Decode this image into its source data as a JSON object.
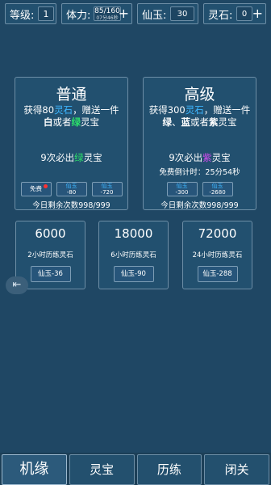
{
  "stats": {
    "level": {
      "label": "等级:",
      "value": "1"
    },
    "stamina": {
      "label": "体力:",
      "value": "85/160",
      "timer": "07分46秒",
      "plus": "+"
    },
    "jade": {
      "label": "仙玉:",
      "value": "30"
    },
    "stone": {
      "label": "灵石:",
      "value": "0",
      "plus": "+"
    }
  },
  "normal": {
    "title": "普通",
    "desc_a": "获得80",
    "desc_b": "灵石",
    "desc_c": "，赠送一件",
    "desc2_a": "白",
    "desc2_b": "或者",
    "desc2_c": "绿",
    "desc2_d": "灵宝",
    "promise_a": "9次必出",
    "promise_b": "绿",
    "promise_c": "灵宝",
    "free_label": "免费",
    "btn1_top": "仙玉",
    "btn1_bot": "-80",
    "btn2_top": "仙玉",
    "btn2_bot": "-720",
    "remain": "今日剩余次数998/999"
  },
  "advanced": {
    "title": "高级",
    "desc_a": "获得300",
    "desc_b": "灵石",
    "desc_c": "，赠送一件",
    "desc2_a": "绿",
    "desc2_b": "、",
    "desc2_c": "蓝",
    "desc2_d": "或者",
    "desc2_e": "紫",
    "desc2_f": "灵宝",
    "promise_a": "9次必出",
    "promise_b": "紫",
    "promise_c": "灵宝",
    "countdown": "免费倒计时：25分54秒",
    "btn1_top": "仙玉",
    "btn1_bot": "-300",
    "btn2_top": "仙玉",
    "btn2_bot": "-2680",
    "remain": "今日剩余次数998/999"
  },
  "training": [
    {
      "amount": "6000",
      "desc": "2小时历练灵石",
      "cost": "仙玉-36"
    },
    {
      "amount": "18000",
      "desc": "6小时历练灵石",
      "cost": "仙玉-90"
    },
    {
      "amount": "72000",
      "desc": "24小时历练灵石",
      "cost": "仙玉-288"
    }
  ],
  "exit_glyph": "⇤",
  "tabs": [
    "机缘",
    "灵宝",
    "历练",
    "闭关"
  ]
}
